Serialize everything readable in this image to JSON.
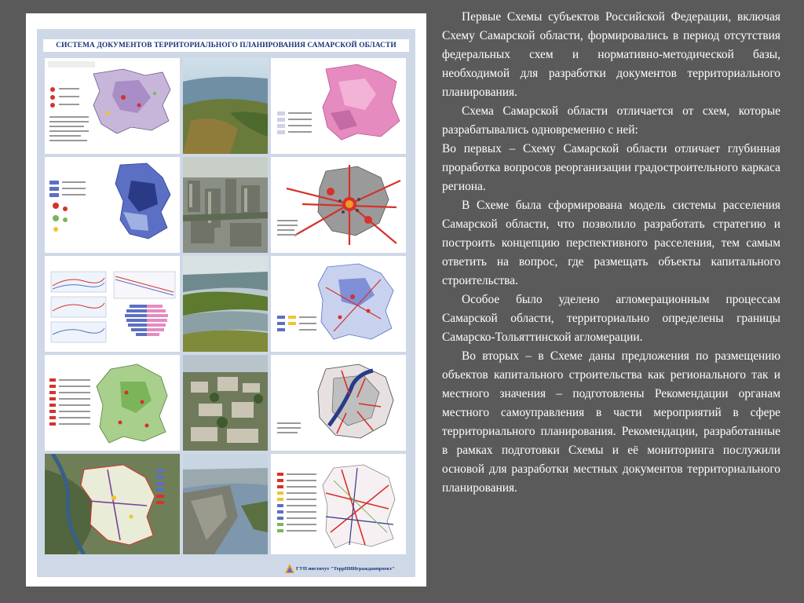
{
  "poster": {
    "title": "СИСТЕМА ДОКУМЕНТОВ ТЕРРИТОРИАЛЬНОГО ПЛАНИРОВАНИЯ САМАРСКОЙ ОБЛАСТИ",
    "footer": "ГУП институт \"ТеррНИИгражданпроект\"",
    "colors": {
      "background": "#cfd8e6",
      "title_text": "#17337a",
      "map_pink": "#e58bc0",
      "map_blue": "#5b6fc4",
      "map_green": "#7bb55a",
      "map_red": "#d6312b"
    }
  },
  "text": {
    "paragraphs": [
      "Первые Схемы субъектов Российской Федерации, включая Схему Самарской области, формировались в период отсутствия федеральных схем и нормативно-методической базы, необходимой для разработки документов территориального планирования.",
      "Схема Самарской области отличается от схем, которые разрабатывались одновременно с ней:",
      "Во первых – Схему Самарской области отличает глубинная проработка вопросов реорганизации градостроительного каркаса региона.",
      "В Схеме была сформирована модель системы расселения Самарской области, что позволило разработать стратегию и построить концепцию перспективного расселения, тем самым ответить на вопрос, где размещать объекты капитального строительства.",
      "Особое было уделено агломерационным процессам Самарской области, территориально определены границы Самарско-Тольяттинской агломерации.",
      "Во вторых – в Схеме даны предложения по размещению объектов капитального строительства как регионального так и местного значения – подготовлены Рекомендации органам местного самоуправления в части мероприятий в сфере территориального планирования. Рекомендации, разработанные в рамках подготовки Схемы и её мониторинга послужили основой для разработки местных документов территориального планирования."
    ]
  }
}
